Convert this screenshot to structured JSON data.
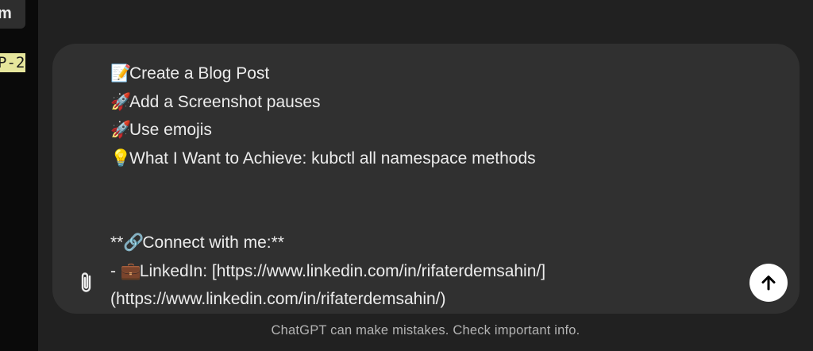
{
  "sidebar": {
    "tab_text": "m",
    "code_text": "P-2"
  },
  "composer": {
    "lines": [
      {
        "icon": "📝",
        "text": "Create a Blog Post"
      },
      {
        "icon": "🚀",
        "text": "Add a Screenshot pauses"
      },
      {
        "icon": "🚀",
        "text": "Use emojis"
      },
      {
        "icon": "💡",
        "text": "What I Want to Achieve: kubctl all namespace methods"
      },
      {
        "icon": "",
        "text": ""
      },
      {
        "icon": "",
        "text": ""
      },
      {
        "prefix": "**",
        "icon": "🔗",
        "text": "Connect with me:**"
      },
      {
        "prefix": "- ",
        "icon": "💼",
        "text": "LinkedIn: [https://www.linkedin.com/in/rifaterdemsahin/]"
      },
      {
        "icon": "",
        "text": "(https://www.linkedin.com/in/rifaterdemsahin/)"
      }
    ],
    "attach_icon": "paperclip-icon",
    "send_icon": "arrow-up-icon"
  },
  "footer": {
    "disclaimer": "ChatGPT can make mistakes. Check important info."
  }
}
